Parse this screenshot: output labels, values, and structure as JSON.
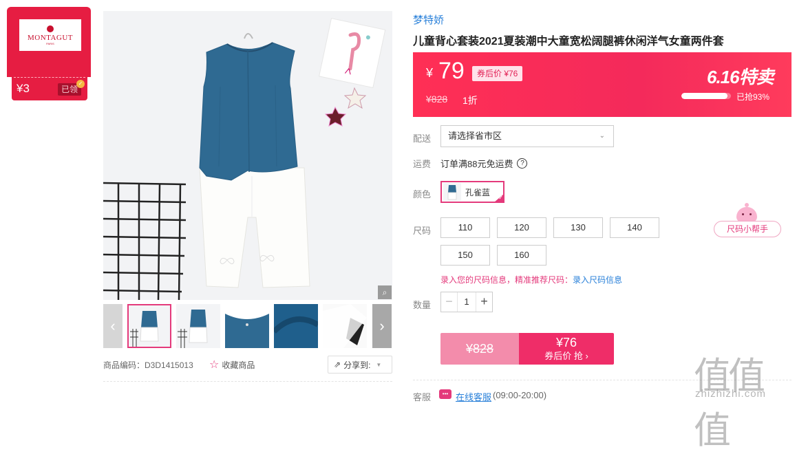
{
  "coupon": {
    "logo_text": "MONTAGUT",
    "logo_sub": "PARIS",
    "amount": "¥3",
    "claimed": "已领"
  },
  "gallery": {
    "thumb_count": 5,
    "sku_label": "商品编码：",
    "sku_value": "D3D1415013",
    "favorite": "收藏商品",
    "share": "分享到:"
  },
  "product": {
    "brand": "梦特娇",
    "title": "儿童背心套装2021夏装潮中大童宽松阔腿裤休闲洋气女童两件套"
  },
  "price": {
    "currency": "¥",
    "current": "79",
    "after_coupon": "券后价 ¥76",
    "original": "¥828",
    "discount": "1折",
    "promo": "6.16特卖",
    "sold_pct": 93,
    "sold_label": "已抢93%"
  },
  "delivery": {
    "label": "配送",
    "placeholder": "请选择省市区"
  },
  "shipping": {
    "label": "运费",
    "text": "订单满88元免运费"
  },
  "color": {
    "label": "颜色",
    "selected": "孔雀蓝"
  },
  "size": {
    "label": "尺码",
    "options": [
      "110",
      "120",
      "130",
      "140",
      "150",
      "160"
    ],
    "helper": "尺码小帮手",
    "tip": "录入您的尺码信息，精准推荐尺码：",
    "tip_link": "录入尺码信息"
  },
  "quantity": {
    "label": "数量",
    "value": "1"
  },
  "buy": {
    "original": "¥828",
    "price": "¥76",
    "action": "券后价 抢 ›"
  },
  "service": {
    "label": "客服",
    "link": "在线客服",
    "hours": "(09:00-20:00)"
  },
  "watermark": {
    "big": "值值值",
    "small": "zhizhizhi.com"
  },
  "colors": {
    "accent": "#e4397b",
    "price_bar": "#f42a5b",
    "link": "#2980d9",
    "top_blue": "#2f6a92"
  }
}
